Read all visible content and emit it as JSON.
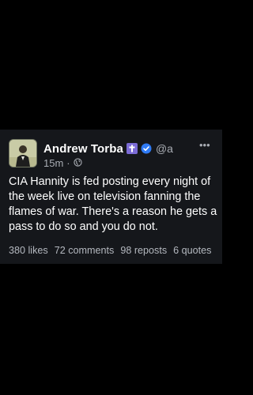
{
  "post": {
    "author": {
      "display_name": "Andrew Torba",
      "handle": "@a",
      "badges": [
        "cross-icon",
        "verified-icon"
      ]
    },
    "meta": {
      "time": "15m",
      "separator": "·",
      "visibility_icon": "globe-icon"
    },
    "more_label": "•••",
    "text_lines": [
      "CIA Hannity is fed posting every night of",
      "the week live on television fanning the",
      "flames of war. There's a reason he gets a",
      "pass to do so and you do not."
    ],
    "stats": {
      "likes": "380 likes",
      "comments": "72 comments",
      "reposts": "98 reposts",
      "quotes": "6 quotes"
    }
  },
  "colors": {
    "background": "#000000",
    "card": "#15171b",
    "text": "#ffffff",
    "muted": "#a8acb3",
    "verified": "#2f7bf5",
    "cross_badge": "#7b6bd6"
  }
}
